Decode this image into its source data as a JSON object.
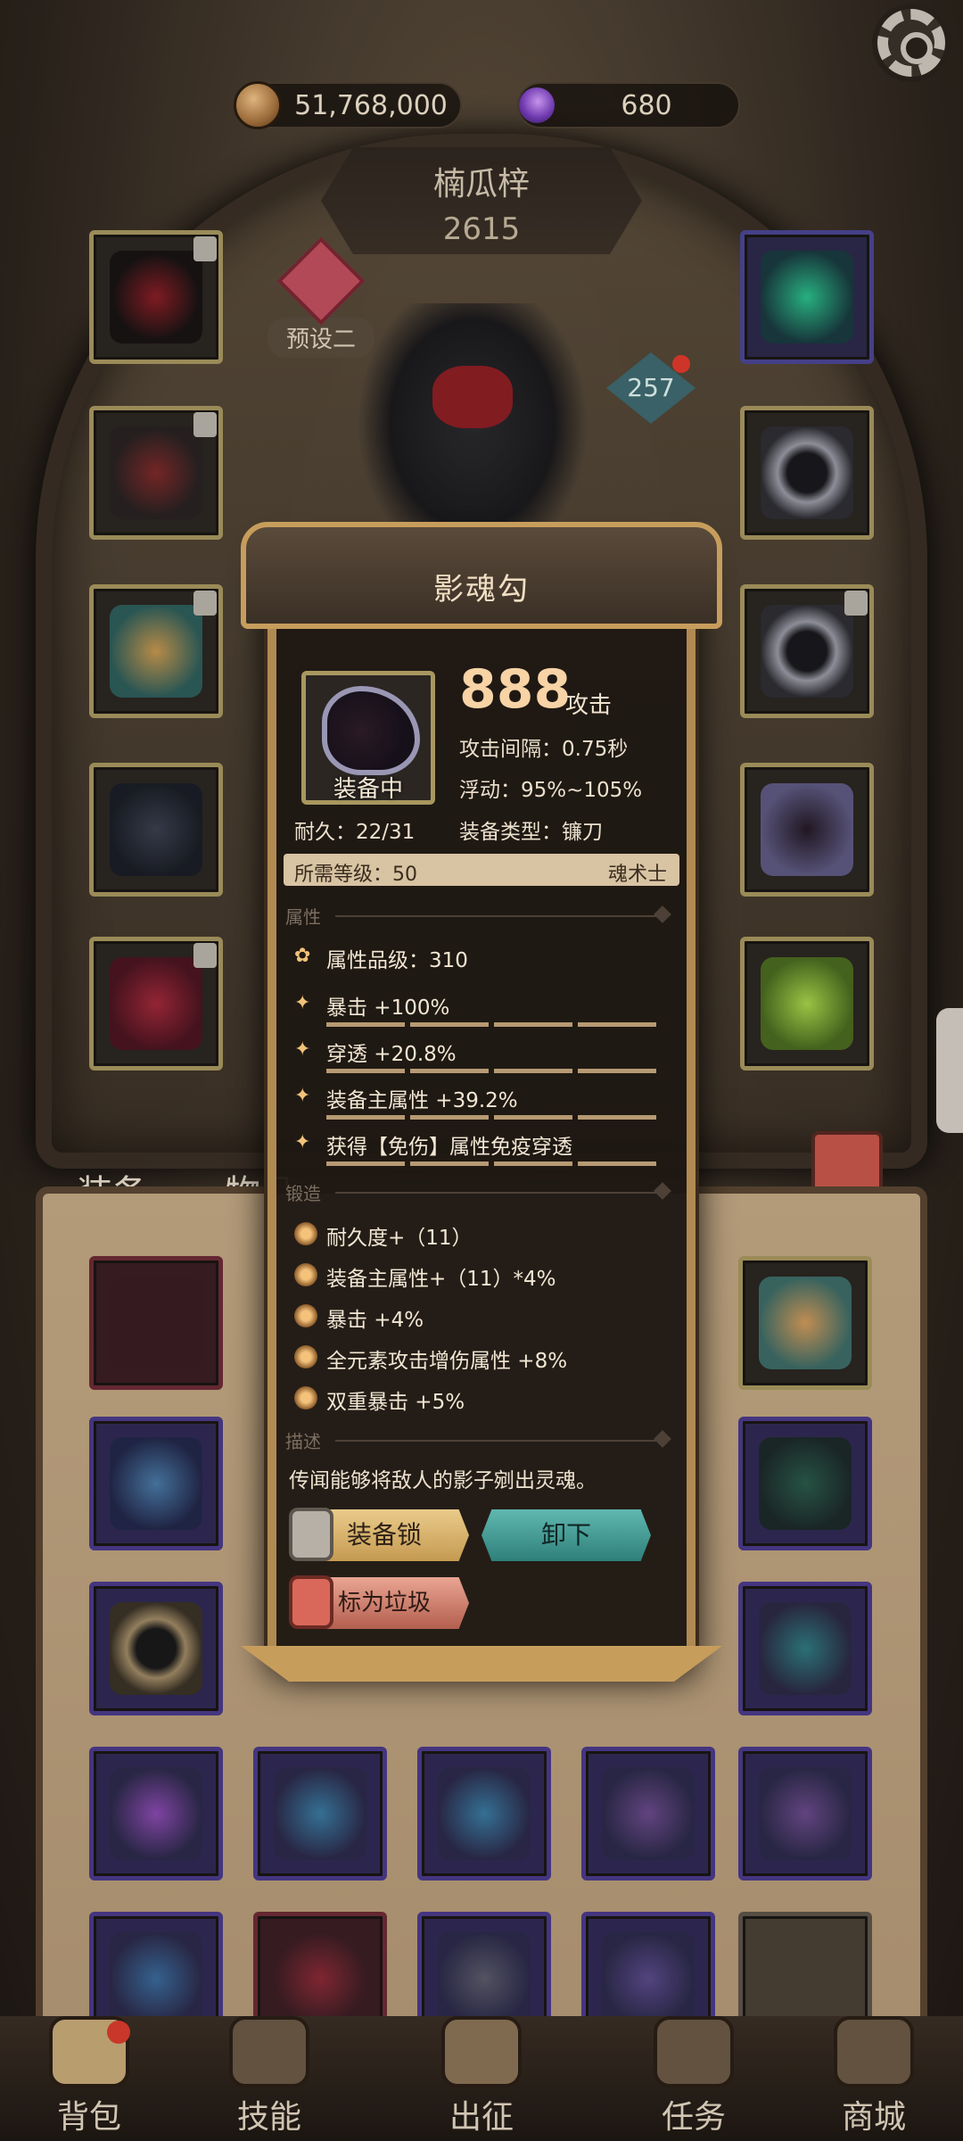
{
  "currencies": {
    "gold": "51,768,000",
    "gems": "680"
  },
  "hero": {
    "name": "楠瓜梓",
    "power": "2615",
    "preset_label": "预设二",
    "level": "257"
  },
  "tabs": {
    "equipment": "装备",
    "items": "物品"
  },
  "bottom_nav": [
    {
      "label": "背包",
      "icon": "backpack-icon"
    },
    {
      "label": "技能",
      "icon": "skill-book-icon"
    },
    {
      "label": "出征",
      "icon": "sword-icon"
    },
    {
      "label": "任务",
      "icon": "scroll-icon"
    },
    {
      "label": "商城",
      "icon": "shop-icon"
    }
  ],
  "item": {
    "name": "影魂勾",
    "equipped_label": "装备中",
    "attack_value": "888",
    "attack_unit": "攻击",
    "attack_interval": "攻击间隔：0.75秒",
    "variance": "浮动：95%~105%",
    "durability": "耐久：22/31",
    "equip_type": "装备类型：镰刀",
    "required_level": "所需等级：50",
    "class": "魂术士",
    "section_attr": "属性",
    "attr_grade": "属性品级：310",
    "attributes": [
      "暴击 +100%",
      "穿透 +20.8%",
      "装备主属性 +39.2%",
      "获得【免伤】属性免疫穿透"
    ],
    "section_forge": "锻造",
    "forge": [
      "耐久度+（11）",
      "装备主属性+（11）*4%",
      "暴击 +4%",
      "全元素攻击增伤属性 +8%",
      "双重暴击 +5%"
    ],
    "section_desc": "描述",
    "description": "传闻能够将敌人的影子剜出灵魂。"
  },
  "buttons": {
    "lock": "装备锁",
    "unequip": "卸下",
    "mark_trash": "标为垃圾"
  },
  "colors": {
    "accent_gold": "#b08a52",
    "attack_value": "#f7d3a6",
    "unequip_teal": "#2f807a",
    "trash_red": "#b45f4f"
  }
}
